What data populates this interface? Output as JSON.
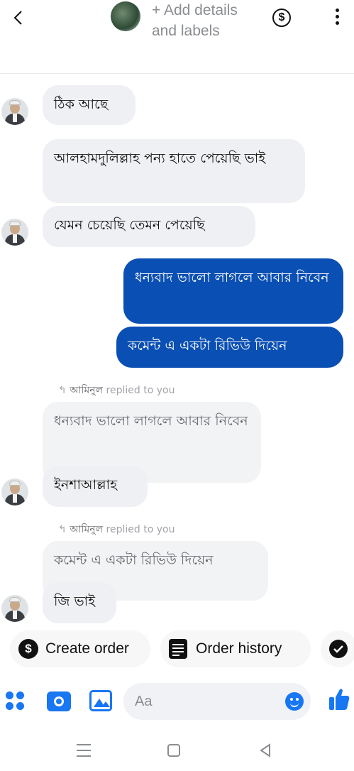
{
  "header": {
    "title": "+ Add details and labels",
    "currency_symbol": "$"
  },
  "messages": [
    {
      "text": "ঠিক আছে",
      "direction": "incoming"
    },
    {
      "text": "আলহামদুলিল্লাহ পন্য হাতে পেয়েছি ভাই",
      "direction": "incoming"
    },
    {
      "text": "যেমন চেয়েছি তেমন পেয়েছি",
      "direction": "incoming"
    },
    {
      "text": "ধন্যবাদ ভালো লাগলে আবার নিবেন",
      "direction": "outgoing"
    },
    {
      "text": "কমেন্ট এ একটা রিভিউ দিয়েন",
      "direction": "outgoing"
    },
    {
      "text": "ইনশাআল্লাহ",
      "direction": "incoming"
    },
    {
      "text": "জি ভাই",
      "direction": "incoming"
    }
  ],
  "replies": [
    {
      "name": "আমিনুল",
      "label": "replied to you",
      "quoted": "ধন্যবাদ ভালো লাগলে আবার নিবেন"
    },
    {
      "name": "আমিনুল",
      "label": "replied to you",
      "quoted": "কমেন্ট এ একটা রিভিউ দিয়েন"
    }
  ],
  "actions": {
    "create_order": "Create order",
    "order_history": "Order history"
  },
  "composer": {
    "placeholder": "Aa"
  },
  "colors": {
    "outgoing_bubble": "#0a4fb3",
    "incoming_bubble": "#eff0f3",
    "accent": "#1877f2"
  }
}
